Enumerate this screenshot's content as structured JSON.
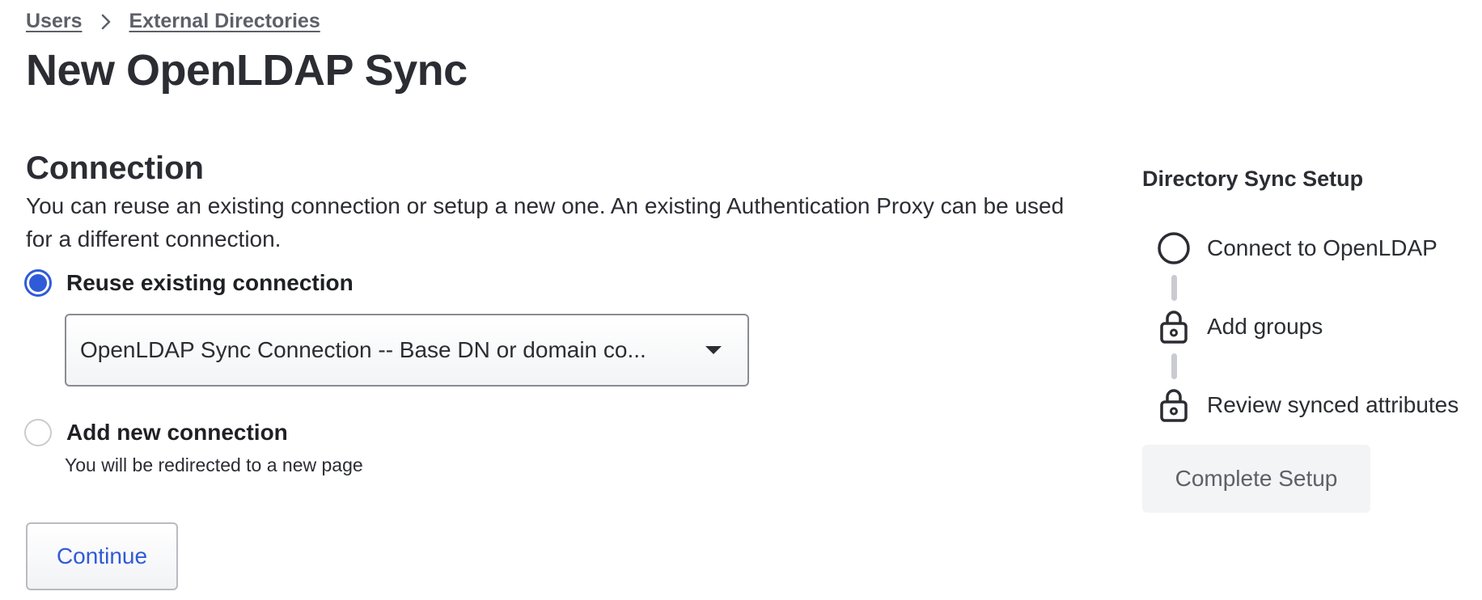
{
  "breadcrumb": {
    "items": [
      "Users",
      "External Directories"
    ]
  },
  "page": {
    "title": "New OpenLDAP Sync"
  },
  "connection": {
    "title": "Connection",
    "description": "You can reuse an existing connection or setup a new one. An existing Authentication Proxy can be used for a different connection.",
    "options": [
      {
        "label": "Reuse existing connection",
        "checked": true
      },
      {
        "label": "Add new connection",
        "checked": false,
        "helper": "You will be redirected to a new page"
      }
    ],
    "select": {
      "selected": "OpenLDAP Sync Connection -- Base DN or domain co..."
    },
    "continue_label": "Continue"
  },
  "sidebar": {
    "title": "Directory Sync Setup",
    "steps": [
      {
        "label": "Connect to OpenLDAP",
        "icon": "circle-icon",
        "state": "current"
      },
      {
        "label": "Add groups",
        "icon": "lock-icon",
        "state": "locked"
      },
      {
        "label": "Review synced attributes",
        "icon": "lock-icon",
        "state": "locked"
      }
    ],
    "complete_label": "Complete Setup"
  },
  "colors": {
    "accent": "#2f5bd8",
    "text": "#2b2d33",
    "muted": "#5d6068",
    "connector": "#c9cbd0"
  }
}
